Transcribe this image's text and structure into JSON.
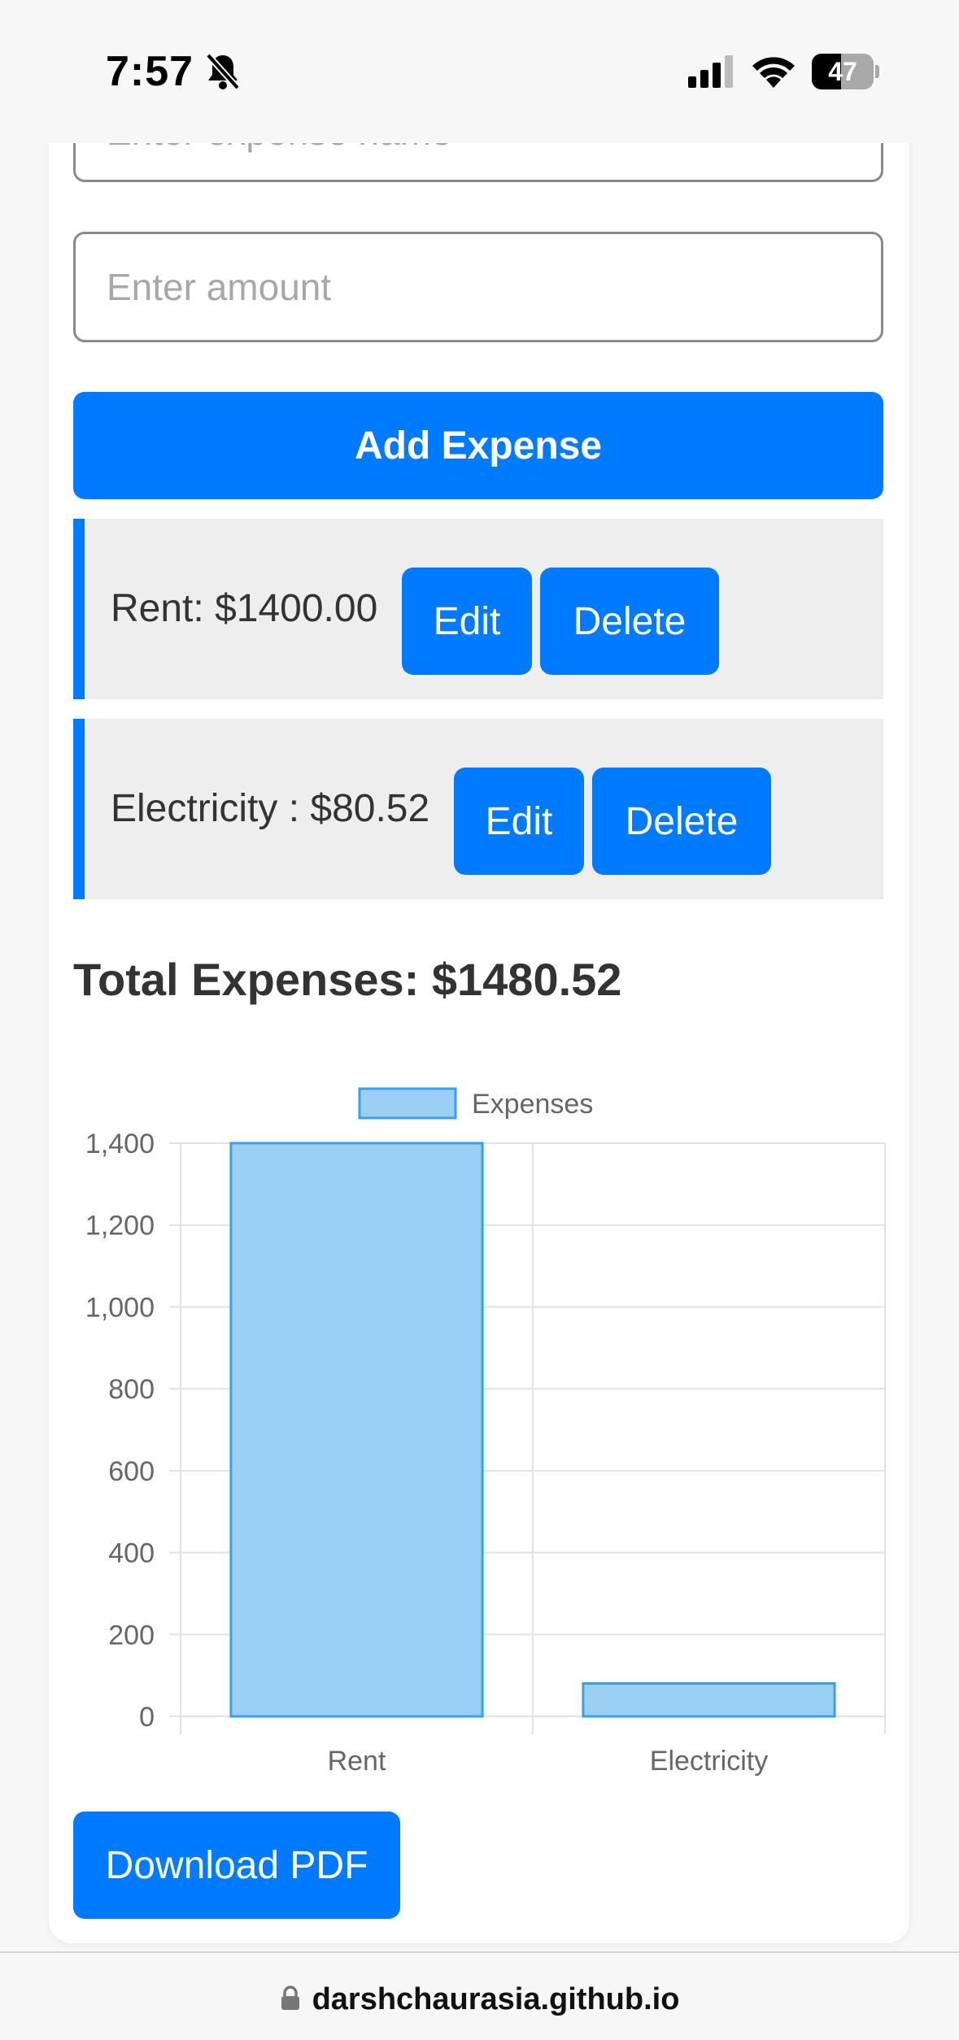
{
  "status": {
    "time": "7:57",
    "battery": "47",
    "battery_fraction": 0.47
  },
  "form": {
    "name_placeholder": "Enter expense name",
    "amount_placeholder": "Enter amount",
    "add_label": "Add Expense"
  },
  "expenses": [
    {
      "label": "Rent: $1400.00",
      "edit": "Edit",
      "delete": "Delete"
    },
    {
      "label": "Electricity : $80.52",
      "edit": "Edit",
      "delete": "Delete"
    }
  ],
  "total": "Total Expenses: $1480.52",
  "chart_data": {
    "type": "bar",
    "categories": [
      "Rent",
      "Electricity"
    ],
    "series": [
      {
        "name": "Expenses",
        "values": [
          1400,
          80.52
        ]
      }
    ],
    "ylim": [
      0,
      1400
    ],
    "yticks": [
      "0",
      "200",
      "400",
      "600",
      "800",
      "1,000",
      "1,200",
      "1,400"
    ],
    "grid": true,
    "legend": "top-center",
    "colors": {
      "fill": "#9ccff4",
      "stroke": "#36a2eb"
    }
  },
  "download_label": "Download PDF",
  "url": "darshchaurasia.github.io",
  "colors": {
    "accent": "#007bff",
    "item_bg": "#eeeeee"
  }
}
